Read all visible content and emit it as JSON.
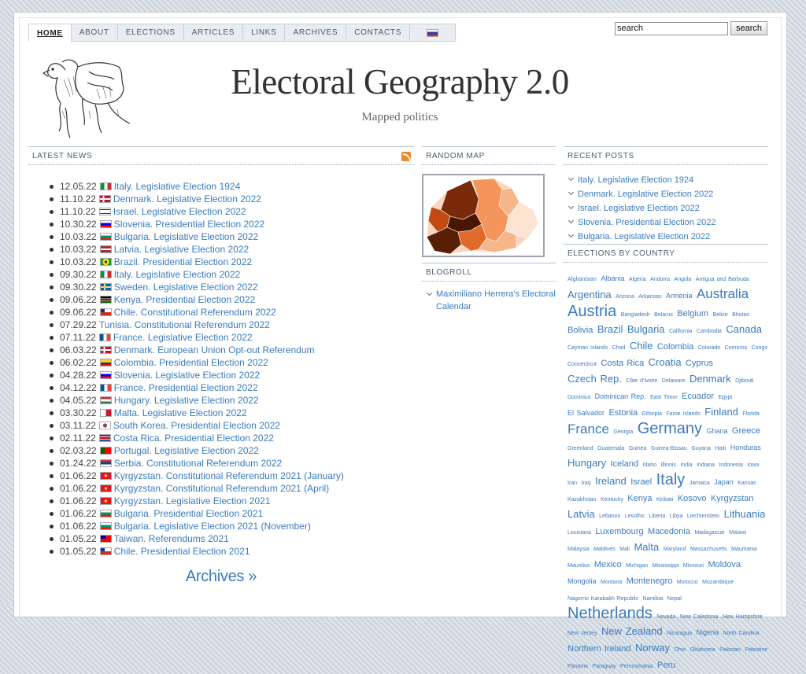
{
  "nav": {
    "items": [
      "HOME",
      "ABOUT",
      "ELECTIONS",
      "ARTICLES",
      "LINKS",
      "ARCHIVES",
      "CONTACTS"
    ],
    "active_index": 0,
    "language_flag_icon": "russia-flag-icon"
  },
  "search": {
    "value": "search",
    "button": "search"
  },
  "site": {
    "title": "Electoral Geography 2.0",
    "tagline": "Mapped politics"
  },
  "latest_news": {
    "heading": "LATEST NEWS",
    "items": [
      {
        "date": "12.05.22",
        "flag": "italy",
        "title": "Italy. Legislative Election 1924"
      },
      {
        "date": "11.10.22",
        "flag": "denmark",
        "title": "Denmark. Legislative Election 2022"
      },
      {
        "date": "11.10.22",
        "flag": "israel",
        "title": "Israel. Legislative Election 2022"
      },
      {
        "date": "10.30.22",
        "flag": "slovenia",
        "title": "Slovenia. Presidential Election 2022"
      },
      {
        "date": "10.03.22",
        "flag": "bulgaria",
        "title": "Bulgaria. Legislative Election 2022"
      },
      {
        "date": "10.03.22",
        "flag": "latvia",
        "title": "Latvia. Legislative Election 2022"
      },
      {
        "date": "10.03.22",
        "flag": "brazil",
        "title": "Brazil. Presidential Election 2022"
      },
      {
        "date": "09.30.22",
        "flag": "italy",
        "title": "Italy. Legislative Election 2022"
      },
      {
        "date": "09.30.22",
        "flag": "sweden",
        "title": "Sweden. Legislative Election 2022"
      },
      {
        "date": "09.06.22",
        "flag": "kenya",
        "title": "Kenya. Presidential Election 2022"
      },
      {
        "date": "09.06.22",
        "flag": "chile",
        "title": "Chile. Constitutional Referendum 2022"
      },
      {
        "date": "07.29.22",
        "flag": "",
        "title": "Tunisia. Constitutional Referendum 2022"
      },
      {
        "date": "07.11.22",
        "flag": "france",
        "title": "France. Legislative Election 2022"
      },
      {
        "date": "06.03.22",
        "flag": "denmark",
        "title": "Denmark. European Union Opt-out Referendum"
      },
      {
        "date": "06.02.22",
        "flag": "colombia",
        "title": "Colombia. Presidential Election 2022"
      },
      {
        "date": "04.28.22",
        "flag": "slovenia",
        "title": "Slovenia. Legislative Election 2022"
      },
      {
        "date": "04.12.22",
        "flag": "france",
        "title": "France. Presidential Election 2022"
      },
      {
        "date": "04.05.22",
        "flag": "hungary",
        "title": "Hungary. Legislative Election 2022"
      },
      {
        "date": "03.30.22",
        "flag": "malta",
        "title": "Malta. Legislative Election 2022"
      },
      {
        "date": "03.11.22",
        "flag": "south-korea",
        "title": "South Korea. Presidential Election 2022"
      },
      {
        "date": "02.11.22",
        "flag": "costa-rica",
        "title": "Costa Rica. Presidential Election 2022"
      },
      {
        "date": "02.03.22",
        "flag": "portugal",
        "title": "Portugal. Legislative Election 2022"
      },
      {
        "date": "01.24.22",
        "flag": "serbia",
        "title": "Serbia. Constitutional Referendum 2022"
      },
      {
        "date": "01.06.22",
        "flag": "kyrgyzstan",
        "title": "Kyrgyzstan. Constitutional Referendum 2021 (January)"
      },
      {
        "date": "01.06.22",
        "flag": "kyrgyzstan",
        "title": "Kyrgyzstan. Constitutional Referendum 2021 (April)"
      },
      {
        "date": "01.06.22",
        "flag": "kyrgyzstan",
        "title": "Kyrgyzstan. Legislative Election 2021"
      },
      {
        "date": "01.06.22",
        "flag": "bulgaria",
        "title": "Bulgaria. Presidential Election 2021"
      },
      {
        "date": "01.06.22",
        "flag": "bulgaria",
        "title": "Bulgaria. Legislative Election 2021 (November)"
      },
      {
        "date": "01.05.22",
        "flag": "taiwan",
        "title": "Taiwan. Referendums 2021"
      },
      {
        "date": "01.05.22",
        "flag": "chile",
        "title": "Chile. Presidential Election 2021"
      }
    ],
    "archives_link": "Archives »"
  },
  "random_map": {
    "heading": "RANDOM MAP"
  },
  "blogroll": {
    "heading": "BLOGROLL",
    "items": [
      "Maximiliano Herrera's Electoral Calendar"
    ]
  },
  "recent_posts": {
    "heading": "RECENT POSTS",
    "items": [
      "Italy. Legislative Election 1924",
      "Denmark. Legislative Election 2022",
      "Israel. Legislative Election 2022",
      "Slovenia. Presidential Election 2022",
      "Bulgaria. Legislative Election 2022"
    ]
  },
  "elections_by_country": {
    "heading": "ELECTIONS BY COUNTRY",
    "tags": [
      {
        "name": "Afghanistan",
        "size": 1
      },
      {
        "name": "Albania",
        "size": 2
      },
      {
        "name": "Algeria",
        "size": 1
      },
      {
        "name": "Andorra",
        "size": 1
      },
      {
        "name": "Angola",
        "size": 1
      },
      {
        "name": "Antigua and Barbuda",
        "size": 1
      },
      {
        "name": "Argentina",
        "size": 4
      },
      {
        "name": "Arizona",
        "size": 1
      },
      {
        "name": "Arkansas",
        "size": 1
      },
      {
        "name": "Armenia",
        "size": 2
      },
      {
        "name": "Australia",
        "size": 5
      },
      {
        "name": "Austria",
        "size": 6
      },
      {
        "name": "Bangladesh",
        "size": 1
      },
      {
        "name": "Belarus",
        "size": 1
      },
      {
        "name": "Belgium",
        "size": 3
      },
      {
        "name": "Belize",
        "size": 1
      },
      {
        "name": "Bhutan",
        "size": 1
      },
      {
        "name": "Bolivia",
        "size": 3
      },
      {
        "name": "Brazil",
        "size": 4
      },
      {
        "name": "Bulgaria",
        "size": 4
      },
      {
        "name": "California",
        "size": 1
      },
      {
        "name": "Cambodia",
        "size": 1
      },
      {
        "name": "Canada",
        "size": 4
      },
      {
        "name": "Cayman Islands",
        "size": 1
      },
      {
        "name": "Chad",
        "size": 1
      },
      {
        "name": "Chile",
        "size": 4
      },
      {
        "name": "Colombia",
        "size": 3
      },
      {
        "name": "Colorado",
        "size": 1
      },
      {
        "name": "Comoros",
        "size": 1
      },
      {
        "name": "Congo",
        "size": 1
      },
      {
        "name": "Connecticut",
        "size": 1
      },
      {
        "name": "Costa Rica",
        "size": 3
      },
      {
        "name": "Croatia",
        "size": 4
      },
      {
        "name": "Cyprus",
        "size": 3
      },
      {
        "name": "Czech Rep.",
        "size": 4
      },
      {
        "name": "Côte d'Ivoire",
        "size": 1
      },
      {
        "name": "Delaware",
        "size": 1
      },
      {
        "name": "Denmark",
        "size": 4
      },
      {
        "name": "Djibouti",
        "size": 1
      },
      {
        "name": "Dominica",
        "size": 1
      },
      {
        "name": "Dominican Rep.",
        "size": 2
      },
      {
        "name": "East Timor",
        "size": 1
      },
      {
        "name": "Ecuador",
        "size": 3
      },
      {
        "name": "Egypt",
        "size": 1
      },
      {
        "name": "El Salvador",
        "size": 2
      },
      {
        "name": "Estonia",
        "size": 3
      },
      {
        "name": "Ethiopia",
        "size": 1
      },
      {
        "name": "Faroe Islands",
        "size": 1
      },
      {
        "name": "Finland",
        "size": 4
      },
      {
        "name": "Florida",
        "size": 1
      },
      {
        "name": "France",
        "size": 5
      },
      {
        "name": "Georgia",
        "size": 1
      },
      {
        "name": "Germany",
        "size": 6
      },
      {
        "name": "Ghana",
        "size": 2
      },
      {
        "name": "Greece",
        "size": 3
      },
      {
        "name": "Greenland",
        "size": 1
      },
      {
        "name": "Guatemala",
        "size": 1
      },
      {
        "name": "Guinea",
        "size": 1
      },
      {
        "name": "Guinea-Bissau",
        "size": 1
      },
      {
        "name": "Guyana",
        "size": 1
      },
      {
        "name": "Haiti",
        "size": 1
      },
      {
        "name": "Honduras",
        "size": 2
      },
      {
        "name": "Hungary",
        "size": 4
      },
      {
        "name": "Iceland",
        "size": 3
      },
      {
        "name": "Idaho",
        "size": 1
      },
      {
        "name": "Illinois",
        "size": 1
      },
      {
        "name": "India",
        "size": 1
      },
      {
        "name": "Indiana",
        "size": 1
      },
      {
        "name": "Indonesia",
        "size": 1
      },
      {
        "name": "Iowa",
        "size": 1
      },
      {
        "name": "Iran",
        "size": 1
      },
      {
        "name": "Iraq",
        "size": 1
      },
      {
        "name": "Ireland",
        "size": 4
      },
      {
        "name": "Israel",
        "size": 3
      },
      {
        "name": "Italy",
        "size": 6
      },
      {
        "name": "Jamaica",
        "size": 1
      },
      {
        "name": "Japan",
        "size": 2
      },
      {
        "name": "Kansas",
        "size": 1
      },
      {
        "name": "Kazakhstan",
        "size": 1
      },
      {
        "name": "Kentucky",
        "size": 1
      },
      {
        "name": "Kenya",
        "size": 3
      },
      {
        "name": "Kiribati",
        "size": 1
      },
      {
        "name": "Kosovo",
        "size": 3
      },
      {
        "name": "Kyrgyzstan",
        "size": 3
      },
      {
        "name": "Latvia",
        "size": 4
      },
      {
        "name": "Lebanon",
        "size": 1
      },
      {
        "name": "Lesotho",
        "size": 1
      },
      {
        "name": "Liberia",
        "size": 1
      },
      {
        "name": "Libya",
        "size": 1
      },
      {
        "name": "Liechtenstein",
        "size": 1
      },
      {
        "name": "Lithuania",
        "size": 4
      },
      {
        "name": "Louisiana",
        "size": 1
      },
      {
        "name": "Luxembourg",
        "size": 3
      },
      {
        "name": "Macedonia",
        "size": 3
      },
      {
        "name": "Madagascar",
        "size": 1
      },
      {
        "name": "Malawi",
        "size": 1
      },
      {
        "name": "Malaysia",
        "size": 1
      },
      {
        "name": "Maldives",
        "size": 1
      },
      {
        "name": "Mali",
        "size": 1
      },
      {
        "name": "Malta",
        "size": 4
      },
      {
        "name": "Maryland",
        "size": 1
      },
      {
        "name": "Massachusetts",
        "size": 1
      },
      {
        "name": "Mauritania",
        "size": 1
      },
      {
        "name": "Mauritius",
        "size": 1
      },
      {
        "name": "Mexico",
        "size": 3
      },
      {
        "name": "Michigan",
        "size": 1
      },
      {
        "name": "Mississippi",
        "size": 1
      },
      {
        "name": "Missouri",
        "size": 1
      },
      {
        "name": "Moldova",
        "size": 3
      },
      {
        "name": "Mongolia",
        "size": 2
      },
      {
        "name": "Montana",
        "size": 1
      },
      {
        "name": "Montenegro",
        "size": 3
      },
      {
        "name": "Morocco",
        "size": 1
      },
      {
        "name": "Mozambique",
        "size": 1
      },
      {
        "name": "Nagorno Karabakh Republic",
        "size": 1
      },
      {
        "name": "Namibia",
        "size": 1
      },
      {
        "name": "Nepal",
        "size": 1
      },
      {
        "name": "Netherlands",
        "size": 6
      },
      {
        "name": "Nevada",
        "size": 1
      },
      {
        "name": "New Caledonia",
        "size": 1
      },
      {
        "name": "New Hampshire",
        "size": 1
      },
      {
        "name": "New Jersey",
        "size": 1
      },
      {
        "name": "New Zealand",
        "size": 4
      },
      {
        "name": "Nicaragua",
        "size": 1
      },
      {
        "name": "Nigeria",
        "size": 2
      },
      {
        "name": "North Carolina",
        "size": 1
      },
      {
        "name": "Northern Ireland",
        "size": 3
      },
      {
        "name": "Norway",
        "size": 4
      },
      {
        "name": "Ohio",
        "size": 1
      },
      {
        "name": "Oklahoma",
        "size": 1
      },
      {
        "name": "Pakistan",
        "size": 1
      },
      {
        "name": "Palestine",
        "size": 1
      },
      {
        "name": "Panama",
        "size": 1
      },
      {
        "name": "Paraguay",
        "size": 1
      },
      {
        "name": "Pennsylvania",
        "size": 1
      },
      {
        "name": "Peru",
        "size": 3
      }
    ]
  },
  "colors": {
    "link": "#3a7bbd",
    "heading": "#4c5d6e",
    "map_dark": "#5a1e05",
    "map_light": "#fbd5bf"
  }
}
